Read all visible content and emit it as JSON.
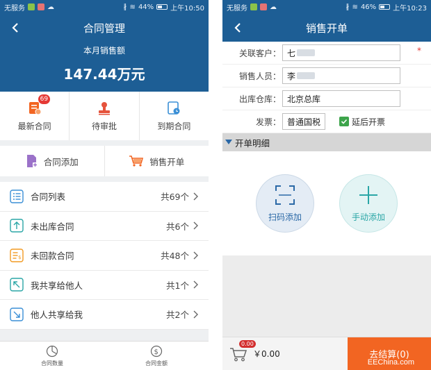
{
  "left": {
    "status": {
      "carrier": "无服务",
      "battery": "44%",
      "time": "上午10:50"
    },
    "title": "合同管理",
    "sales_label": "本月销售额",
    "sales_value": "147.44万元",
    "grid": [
      {
        "label": "最新合同",
        "badge": "69"
      },
      {
        "label": "待审批"
      },
      {
        "label": "到期合同"
      }
    ],
    "actions": [
      {
        "label": "合同添加"
      },
      {
        "label": "销售开单"
      }
    ],
    "list": [
      {
        "label": "合同列表",
        "count": "共69个"
      },
      {
        "label": "未出库合同",
        "count": "共6个"
      },
      {
        "label": "未回款合同",
        "count": "共48个"
      },
      {
        "label": "我共享给他人",
        "count": "共1个"
      },
      {
        "label": "他人共享给我",
        "count": "共2个"
      }
    ],
    "tabs": [
      {
        "label": "合同数量"
      },
      {
        "label": "合同金额"
      }
    ]
  },
  "right": {
    "status": {
      "carrier": "无服务",
      "battery": "46%",
      "time": "上午10:23"
    },
    "title": "销售开单",
    "form": {
      "customer_label": "关联客户：",
      "customer_value": "七",
      "required_mark": "*",
      "salesperson_label": "销售人员：",
      "salesperson_value": "李",
      "warehouse_label": "出库仓库：",
      "warehouse_value": "北京总库",
      "invoice_label": "发票：",
      "invoice_value": "普通国税",
      "deferred_label": "延后开票"
    },
    "section_title": "开单明细",
    "scan_label": "扫码添加",
    "manual_label": "手动添加",
    "cart_badge": "0.00",
    "cart_total": "￥0.00",
    "checkout_label": "去结算(0)",
    "watermark": "EEChina.com"
  },
  "colors": {
    "primary": "#1d5e95",
    "accent": "#f26522",
    "badge": "#e53935",
    "check": "#3da44b"
  }
}
